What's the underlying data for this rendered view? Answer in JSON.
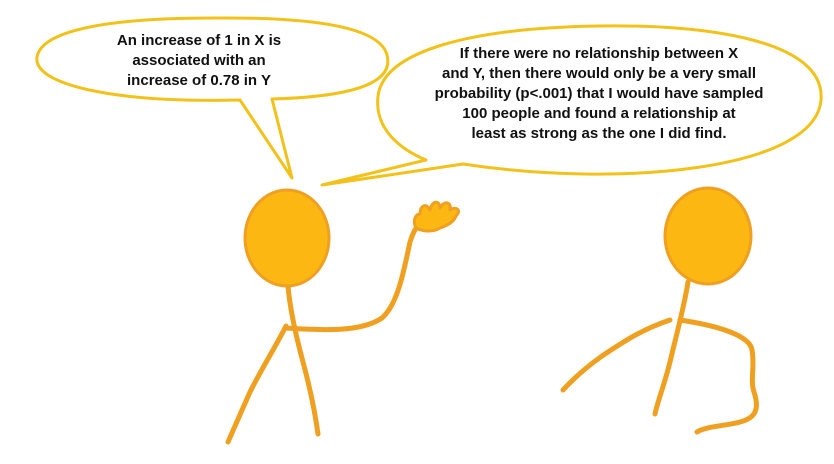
{
  "speech_bubbles": {
    "left": {
      "text": "An increase of 1 in X is\nassociated with an\nincrease of 0.78 in Y"
    },
    "right": {
      "text": "If there were no relationship between X\nand Y, then there would only be a very small\nprobability (p<.001) that I would have sampled\n100 people and found a relationship at\nleast as strong as the one I did find."
    }
  },
  "colors": {
    "figure_fill": "#fcb712",
    "figure_stroke": "#f0a020",
    "bubble_fill": "#ffffff",
    "bubble_stroke": "#f2c21a",
    "text": "#111111"
  }
}
